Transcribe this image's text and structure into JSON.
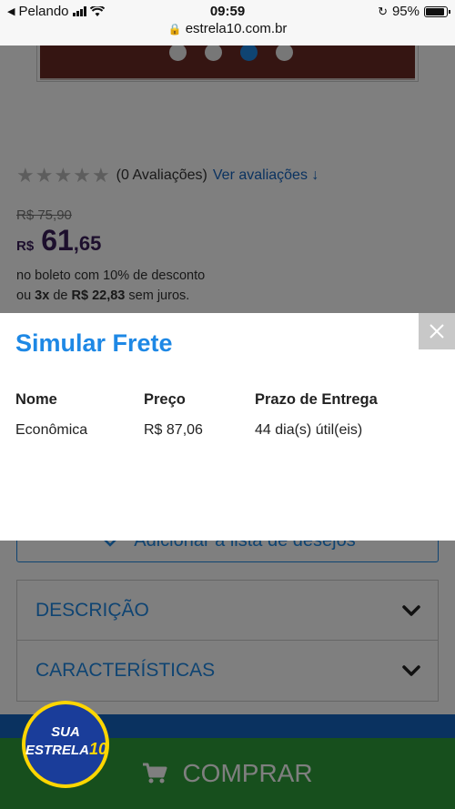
{
  "status_bar": {
    "carrier": "Pelando",
    "time": "09:59",
    "url": "estrela10.com.br",
    "battery": "95%",
    "battery_level": 0.95
  },
  "product": {
    "gallery": {
      "dots": 4,
      "active_index": 2
    },
    "rating": {
      "stars": 0,
      "max_stars": 5,
      "count_text": "(0 Avaliações)",
      "link": "Ver avaliações"
    },
    "old_price": "R$ 75,90",
    "price": {
      "currency": "R$",
      "integer": "61",
      "decimal": ",65"
    },
    "boleto_text": "no boleto com 10% de desconto",
    "installments": {
      "prefix": "ou",
      "times": "3x",
      "middle": "de",
      "value": "R$ 22,83",
      "suffix": "sem juros."
    },
    "wishlist_label": "Adicionar a lista de desejos",
    "accordion": [
      {
        "label": "DESCRIÇÃO"
      },
      {
        "label": "CARACTERÍSTICAS"
      }
    ],
    "buy_label": "COMPRAR",
    "badge": {
      "line1": "SUA",
      "line2": "ESTRELA",
      "line2_num": "10"
    }
  },
  "modal": {
    "title": "Simular Frete",
    "headers": [
      "Nome",
      "Preço",
      "Prazo de Entrega"
    ],
    "rows": [
      [
        "Econômica",
        "R$ 87,06",
        "44 dia(s) útil(eis)"
      ]
    ]
  },
  "colors": {
    "accent": "#1e88e5",
    "price": "#3b1e5a",
    "buy": "#2e9e3a",
    "brand_blue": "#1565c0",
    "badge_yellow": "#ffd600"
  }
}
